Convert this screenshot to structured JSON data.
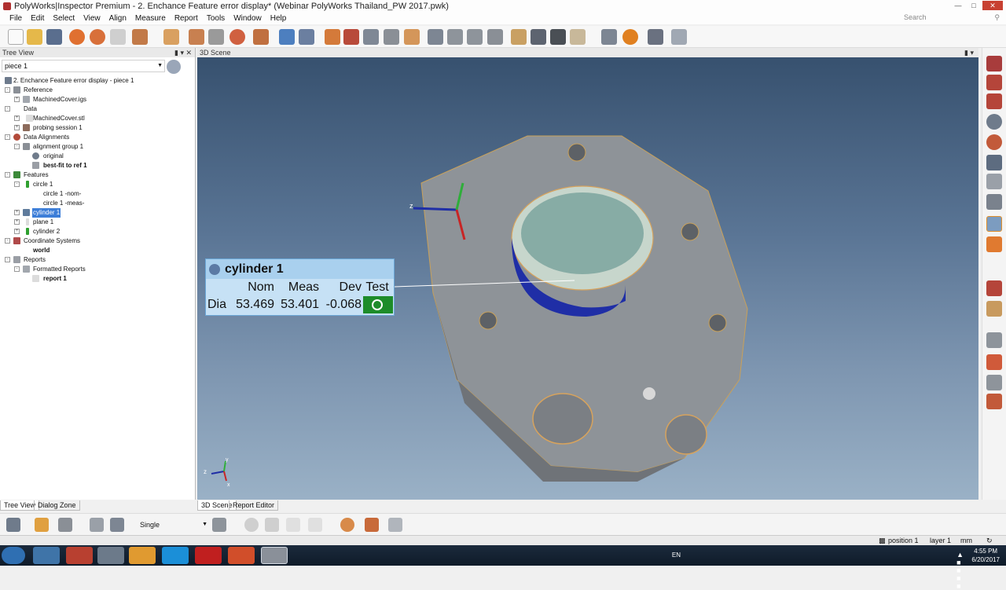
{
  "window": {
    "title": "PolyWorks|Inspector Premium - 2. Enchance Feature error display* (Webinar PolyWorks Thailand_PW 2017.pwk)"
  },
  "menu": [
    "File",
    "Edit",
    "Select",
    "View",
    "Align",
    "Measure",
    "Report",
    "Tools",
    "Window",
    "Help"
  ],
  "search": {
    "placeholder": "Search"
  },
  "tree_panel": {
    "title": "Tree View",
    "combo_value": "piece 1",
    "root": "2. Enchance Feature error display - piece 1",
    "nodes": [
      {
        "label": "Reference",
        "level": 1
      },
      {
        "label": "MachinedCover.igs",
        "level": 2
      },
      {
        "label": "Data",
        "level": 1
      },
      {
        "label": "MachinedCover.stl",
        "level": 2
      },
      {
        "label": "probing session 1",
        "level": 2
      },
      {
        "label": "Data Alignments",
        "level": 1
      },
      {
        "label": "alignment group 1",
        "level": 2
      },
      {
        "label": "original",
        "level": 3
      },
      {
        "label": "best-fit to ref 1",
        "level": 3
      },
      {
        "label": "Features",
        "level": 1
      },
      {
        "label": "circle 1",
        "level": 2
      },
      {
        "label": "circle 1 -nom-",
        "level": 3
      },
      {
        "label": "circle 1 -meas-",
        "level": 3
      },
      {
        "label": "cylinder 1",
        "level": 2
      },
      {
        "label": "plane 1",
        "level": 2
      },
      {
        "label": "cylinder 2",
        "level": 2
      },
      {
        "label": "Coordinate Systems",
        "level": 1
      },
      {
        "label": "world",
        "level": 2
      },
      {
        "label": "Reports",
        "level": 1
      },
      {
        "label": "Formatted Reports",
        "level": 2
      },
      {
        "label": "report 1",
        "level": 3
      }
    ],
    "tabs": [
      "Tree View",
      "Dialog Zone"
    ]
  },
  "scene": {
    "title": "3D Scene",
    "tabs": [
      "3D Scene",
      "Report Editor"
    ],
    "axes": {
      "x": "x",
      "y": "y",
      "z": "z"
    },
    "callout": {
      "title": "cylinder 1",
      "columns": [
        "Nom",
        "Meas",
        "Dev",
        "Test"
      ],
      "row_label": "Dia",
      "nom": "53.469",
      "meas": "53.401",
      "dev": "-0.068",
      "test_status": "pass"
    }
  },
  "bottom_toolbar": {
    "mode": "Single"
  },
  "statusbar": {
    "position": "position 1",
    "layer": "layer 1",
    "unit": "mm"
  },
  "taskbar": {
    "lang": "EN",
    "time": "4:55 PM",
    "date": "6/20/2017"
  },
  "colors": {
    "accent": "#3d7ed8",
    "callout_header": "#a9d0ee",
    "callout_body": "#c6e1f5",
    "pass": "#1d8c2a",
    "scene_top": "#37516f",
    "scene_bottom": "#9ab1c6",
    "part_grey": "#8e9398",
    "cylinder_blue": "#1f2ea6"
  }
}
